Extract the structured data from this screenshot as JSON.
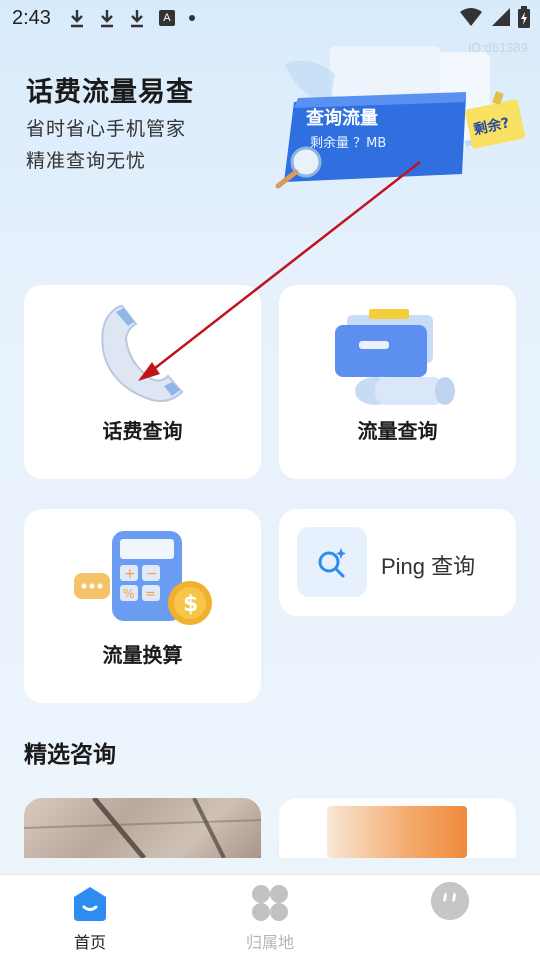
{
  "status_bar": {
    "time": "2:43"
  },
  "device_id": "ID:d61389",
  "hero": {
    "title": "话费流量易查",
    "subtitle_1": "省时省心手机管家",
    "subtitle_2": "精准查询无忧",
    "card_title": "查询流量",
    "card_sub": "剩余量 ？MB",
    "sticky_note": "剩余?"
  },
  "features": {
    "bill_query": "话费查询",
    "data_query": "流量查询",
    "data_convert": "流量换算",
    "ping_query": "Ping 查询"
  },
  "section": {
    "title": "精选咨询"
  },
  "bottom_nav": [
    {
      "label": "首页",
      "active": true
    },
    {
      "label": "归属地",
      "active": false
    },
    {
      "label": "",
      "active": false
    }
  ],
  "colors": {
    "accent": "#2d8cf0",
    "nav_active": "#222222",
    "nav_inactive": "#b5b5b5",
    "annotation_arrow": "#c0141c"
  },
  "icons": {
    "status": [
      "download-icon",
      "download-icon",
      "download-icon",
      "a-icon",
      "dot-icon",
      "wifi-icon",
      "signal-icon",
      "battery-icon"
    ],
    "nav": [
      "home-icon",
      "grid-icon",
      "avatar-icon"
    ]
  }
}
